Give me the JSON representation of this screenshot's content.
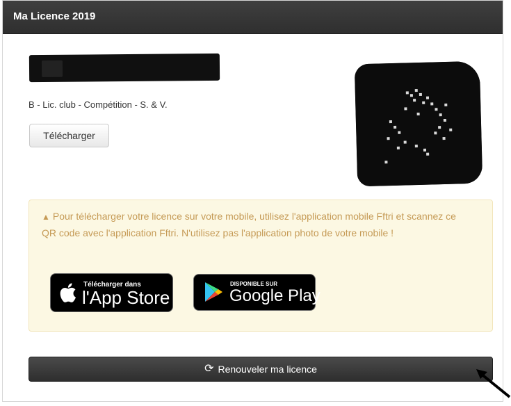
{
  "panel": {
    "title": "Ma Licence 2019"
  },
  "licence": {
    "type_text": "B - Lic. club - Compétition - S. & V.",
    "download_label": "Télécharger"
  },
  "alert": {
    "warning_icon": "warning-triangle-icon",
    "text": "Pour télécharger votre licence sur votre mobile, utilisez l'application mobile Fftri et scannez ce QR code avec l'application Fftri. N'utilisez pas l'application photo de votre mobile !"
  },
  "badges": {
    "apple_small": "Télécharger dans",
    "apple_large": "l'App Store",
    "google_small": "DISPONIBLE SUR",
    "google_large": "Google Play"
  },
  "renew": {
    "icon": "refresh-icon",
    "label": "Renouveler ma licence"
  },
  "colors": {
    "header_bg": "#333333",
    "alert_bg": "#fcf8e3",
    "alert_text": "#c59a55",
    "renew_bg": "#3a3a3a"
  }
}
